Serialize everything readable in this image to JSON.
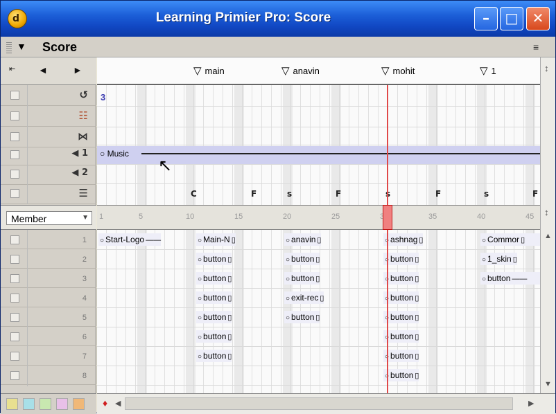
{
  "window": {
    "title": "Learning Primier Pro: Score",
    "icon_glyph": "d",
    "minimize_glyph": "–",
    "maximize_glyph": "□",
    "close_glyph": "✕"
  },
  "panel": {
    "title": "Score",
    "collapse_glyph": "▼",
    "options_glyph": "≡"
  },
  "nav": {
    "left_glyph": "◄",
    "right_glyph": "►",
    "jump_glyph": "⇤"
  },
  "special_channels": [
    {
      "icon": "tempo-icon",
      "glyph": "↺"
    },
    {
      "icon": "palette-icon",
      "glyph": "☷"
    },
    {
      "icon": "transition-icon",
      "glyph": "⋈"
    },
    {
      "icon": "sound1-icon",
      "glyph": "◀ 1"
    },
    {
      "icon": "sound2-icon",
      "glyph": "◀ 2"
    },
    {
      "icon": "script-icon",
      "glyph": "☰"
    }
  ],
  "markers": [
    {
      "label": "main"
    },
    {
      "label": "anavin"
    },
    {
      "label": "mohit"
    },
    {
      "label": "1"
    }
  ],
  "tempo_value": "3",
  "sound_sprite": "Music",
  "script_cells": [
    "C",
    "F",
    "s",
    "F",
    "s",
    "F",
    "s",
    "F"
  ],
  "member_select": {
    "value": "Member"
  },
  "frame_ticks": [
    "1",
    "5",
    "10",
    "15",
    "20",
    "25",
    "30",
    "35",
    "40",
    "45"
  ],
  "playhead_frame": 30,
  "channels": [
    "1",
    "2",
    "3",
    "4",
    "5",
    "6",
    "7",
    "8"
  ],
  "sprites": [
    {
      "label": "Start-Logo",
      "channel": 1,
      "open": true
    },
    {
      "label": "Main-N",
      "channel": 1
    },
    {
      "label": "anavin",
      "channel": 1
    },
    {
      "label": "ashnag",
      "channel": 1
    },
    {
      "label": "Commor",
      "channel": 1
    },
    {
      "label": "button",
      "channel": 2
    },
    {
      "label": "button",
      "channel": 2
    },
    {
      "label": "button",
      "channel": 2
    },
    {
      "label": "1_skin",
      "channel": 2
    },
    {
      "label": "button",
      "channel": 3
    },
    {
      "label": "button",
      "channel": 3
    },
    {
      "label": "button",
      "channel": 3
    },
    {
      "label": "button",
      "channel": 3,
      "open": true
    },
    {
      "label": "button",
      "channel": 4
    },
    {
      "label": "exit-rec",
      "channel": 4
    },
    {
      "label": "button",
      "channel": 4
    },
    {
      "label": "button",
      "channel": 5
    },
    {
      "label": "button",
      "channel": 5
    },
    {
      "label": "button",
      "channel": 5
    },
    {
      "label": "button",
      "channel": 6
    },
    {
      "label": "button",
      "channel": 6
    },
    {
      "label": "button",
      "channel": 7
    },
    {
      "label": "button",
      "channel": 7
    },
    {
      "label": "button",
      "channel": 8
    }
  ],
  "palette_colors": [
    "#e8e090",
    "#a8e0e8",
    "#c8e8b0",
    "#e8c0e8",
    "#f0b878"
  ]
}
